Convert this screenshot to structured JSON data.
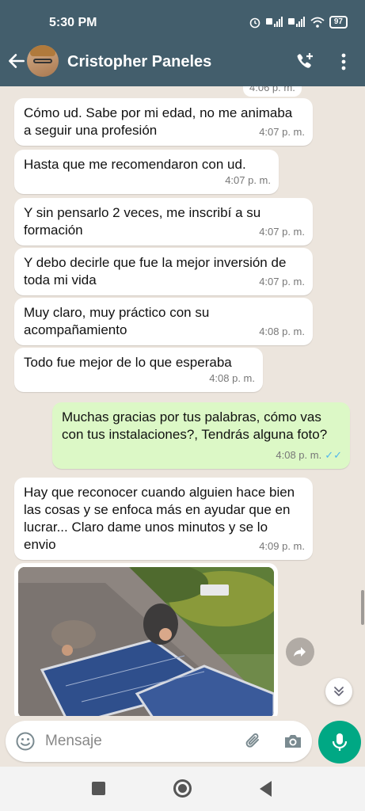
{
  "status_bar": {
    "time": "5:30 PM",
    "battery": "97"
  },
  "header": {
    "contact_name": "Cristopher Paneles"
  },
  "messages": [
    {
      "direction": "in",
      "text": "Cómo ud. Sabe por mi edad, no me animaba a seguir una profesión",
      "time": "4:07 p. m."
    },
    {
      "direction": "in",
      "text": "Hasta que me recomendaron con ud.",
      "time": "4:07 p. m."
    },
    {
      "direction": "in",
      "text": "Y sin pensarlo 2 veces, me inscribí a su formación",
      "time": "4:07 p. m."
    },
    {
      "direction": "in",
      "text": "Y debo decirle que fue la mejor inversión de toda mi vida",
      "time": "4:07 p. m."
    },
    {
      "direction": "in",
      "text": "Muy claro, muy práctico con su acompañamiento",
      "time": "4:08 p. m."
    },
    {
      "direction": "in",
      "text": "Todo fue mejor de lo que esperaba",
      "time": "4:08 p. m."
    },
    {
      "direction": "out",
      "text": "Muchas gracias por tus palabras, cómo vas con tus instalaciones?, Tendrás alguna foto?",
      "time": "4:08 p. m.",
      "read_ticks": "✓✓"
    },
    {
      "direction": "in",
      "text": "Hay que reconocer cuando alguien hace bien las cosas y se enfoca más en ayudar que en lucrar... Claro dame unos minutos y se lo envio",
      "time": "4:09 p. m."
    }
  ],
  "partial_top_time": "4:06 p. m.",
  "composer": {
    "placeholder": "Mensaje"
  },
  "colors": {
    "header": "#435e6c",
    "outgoing": "#dcf8c6",
    "accent": "#00a884",
    "tick": "#4fb6ec"
  },
  "icons": [
    "back-arrow-icon",
    "add-call-icon",
    "more-vert-icon",
    "emoji-icon",
    "attach-icon",
    "camera-icon",
    "mic-icon",
    "forward-icon",
    "chevrons-down-icon"
  ]
}
